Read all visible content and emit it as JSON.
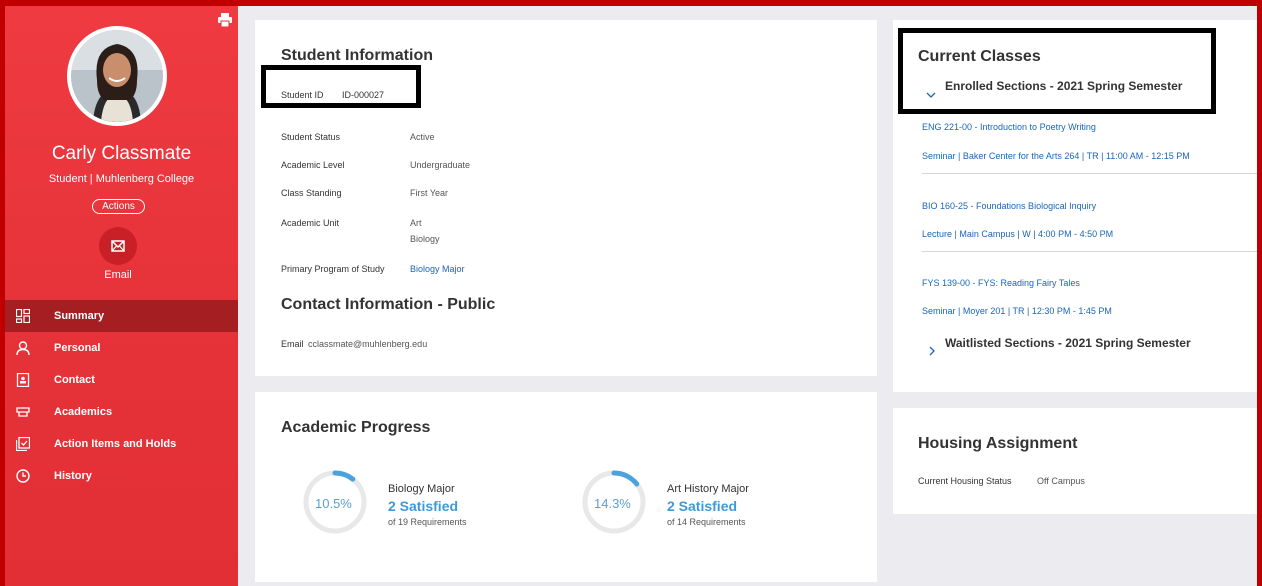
{
  "sidebar": {
    "name": "Carly Classmate",
    "role": "Student | Muhlenberg College",
    "actions_label": "Actions",
    "email_label": "Email",
    "nav": [
      {
        "label": "Summary",
        "icon": "dashboard-icon",
        "active": true
      },
      {
        "label": "Personal",
        "icon": "person-icon"
      },
      {
        "label": "Contact",
        "icon": "contact-card-icon"
      },
      {
        "label": "Academics",
        "icon": "academics-icon"
      },
      {
        "label": "Action Items and Holds",
        "icon": "checklist-icon"
      },
      {
        "label": "History",
        "icon": "clock-icon"
      }
    ]
  },
  "student_info": {
    "title": "Student Information",
    "id_label": "Student ID",
    "id_value": "ID-000027",
    "status_label": "Student Status",
    "status_value": "Active",
    "level_label": "Academic Level",
    "level_value": "Undergraduate",
    "standing_label": "Class Standing",
    "standing_value": "First Year",
    "unit_label": "Academic Unit",
    "unit_values": [
      "Art",
      "Biology"
    ],
    "program_label": "Primary Program of Study",
    "program_value": "Biology Major"
  },
  "contact": {
    "title": "Contact Information - Public",
    "email_label": "Email",
    "email_value": "cclassmate@muhlenberg.edu"
  },
  "progress": {
    "title": "Academic Progress",
    "items": [
      {
        "percent": "10.5%",
        "fraction": 0.105,
        "program": "Biology Major",
        "satisfied": "2 Satisfied",
        "requirements": "of 19 Requirements"
      },
      {
        "percent": "14.3%",
        "fraction": 0.143,
        "program": "Art History Major",
        "satisfied": "2 Satisfied",
        "requirements": "of 14 Requirements"
      }
    ]
  },
  "classes": {
    "title": "Current Classes",
    "enrolled_label": "Enrolled Sections - 2021 Spring Semester",
    "sections": [
      {
        "course": "ENG 221-00 - Introduction to Poetry Writing",
        "detail": "Seminar | Baker Center for the Arts 264 | TR | 11:00 AM - 12:15 PM"
      },
      {
        "course": "BIO 160-25 - Foundations Biological Inquiry",
        "detail": "Lecture | Main Campus | W | 4:00 PM - 4:50 PM"
      },
      {
        "course": "FYS 139-00 - FYS: Reading Fairy Tales",
        "detail": "Seminar | Moyer 201 | TR | 12:30 PM - 1:45 PM"
      }
    ],
    "waitlisted_label": "Waitlisted Sections - 2021 Spring Semester"
  },
  "housing": {
    "title": "Housing Assignment",
    "status_label": "Current Housing Status",
    "status_value": "Off Campus"
  },
  "colors": {
    "sidebar": "#e53238",
    "active_nav": "#a51e22",
    "link": "#1a66b8",
    "progress": "#3d9ad9"
  }
}
